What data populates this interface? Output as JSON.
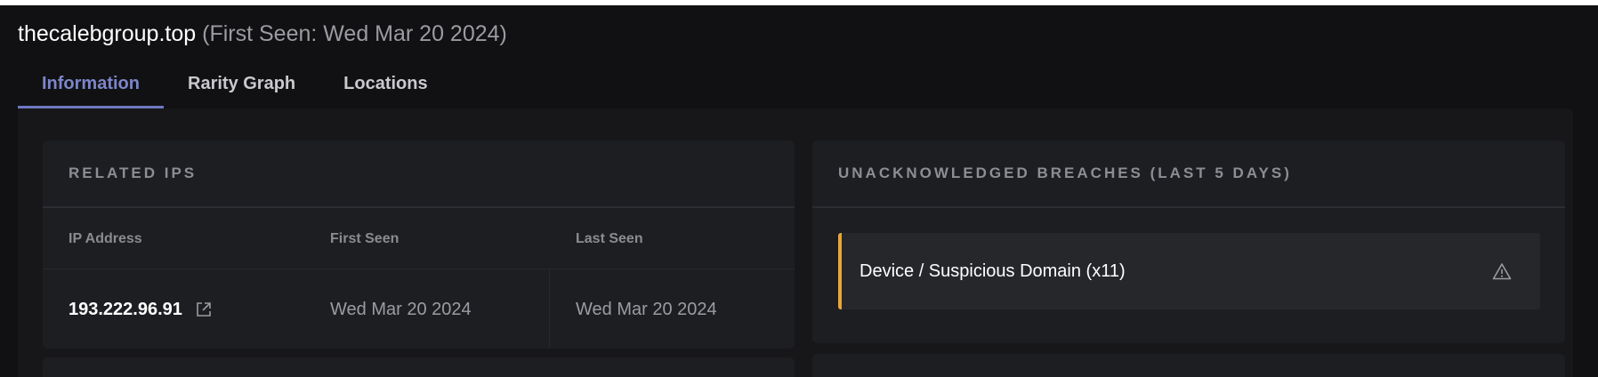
{
  "header": {
    "domain": "thecalebgroup.top",
    "first_seen_text": "(First Seen: Wed Mar 20 2024)"
  },
  "tabs": [
    {
      "label": "Information",
      "active": true
    },
    {
      "label": "Rarity Graph",
      "active": false
    },
    {
      "label": "Locations",
      "active": false
    }
  ],
  "related_ips": {
    "title": "RELATED IPS",
    "columns": [
      "IP Address",
      "First Seen",
      "Last Seen"
    ],
    "rows": [
      {
        "ip": "193.222.96.91",
        "first_seen": "Wed Mar 20 2024",
        "last_seen": "Wed Mar 20 2024"
      }
    ]
  },
  "breaches": {
    "title": "UNACKNOWLEDGED BREACHES (LAST 5 DAYS)",
    "items": [
      {
        "label": "Device / Suspicious Domain (x11)",
        "icon": "warning-icon",
        "accent_color": "#e7a63c"
      }
    ]
  },
  "colors": {
    "background": "#111113",
    "card": "#1d1e22",
    "active_tab": "#7c86c9",
    "warning_accent": "#e7a63c"
  }
}
